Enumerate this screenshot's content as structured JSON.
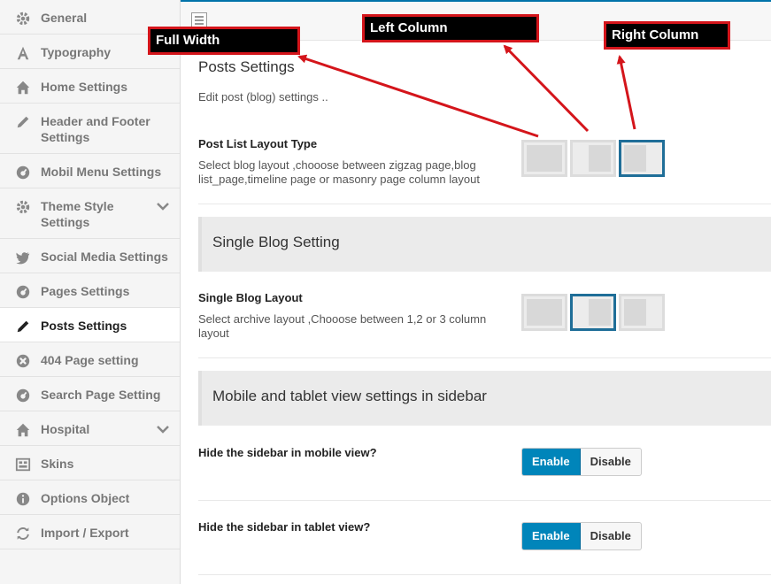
{
  "sidebar": {
    "items": [
      {
        "label": "General",
        "icon": "gear-icon"
      },
      {
        "label": "Typography",
        "icon": "typography-icon"
      },
      {
        "label": "Home Settings",
        "icon": "home-icon"
      },
      {
        "label": "Header and Footer Settings",
        "icon": "pencil-icon"
      },
      {
        "label": "Mobil Menu Settings",
        "icon": "dashboard-icon"
      },
      {
        "label": "Theme Style Settings",
        "icon": "gear-icon"
      },
      {
        "label": "Social Media Settings",
        "icon": "twitter-icon"
      },
      {
        "label": "Pages Settings",
        "icon": "dashboard-icon"
      },
      {
        "label": "Posts Settings",
        "icon": "pencil-icon"
      },
      {
        "label": "404 Page setting",
        "icon": "x-circle-icon"
      },
      {
        "label": "Search Page Setting",
        "icon": "dashboard-icon"
      },
      {
        "label": "Hospital",
        "icon": "home-icon"
      },
      {
        "label": "Skins",
        "icon": "skins-icon"
      },
      {
        "label": "Options Object",
        "icon": "info-icon"
      },
      {
        "label": "Import / Export",
        "icon": "refresh-icon"
      }
    ],
    "active": "Posts Settings"
  },
  "main": {
    "section_title": "Posts Settings",
    "section_desc": "Edit post (blog) settings ..",
    "post_list_layout": {
      "title": "Post List Layout Type",
      "desc_line1": "Select blog layout ,chooose between zigzag page,blog",
      "desc_line2": "list_page,timeline page or masonry page column layout",
      "selected": "right-column"
    },
    "single_blog_band": "Single Blog Setting",
    "single_blog_layout": {
      "title": "Single Blog Layout",
      "desc_line1": "Select archive layout ,Chooose between 1,2 or 3 column",
      "desc_line2": "layout",
      "selected": "left-column"
    },
    "mobile_band": "Mobile and tablet view settings in sidebar",
    "hide_mobile": {
      "title": "Hide the sidebar in mobile view?",
      "enable": "Enable",
      "disable": "Disable",
      "value": "Enable"
    },
    "hide_tablet": {
      "title": "Hide the sidebar in tablet view?",
      "enable": "Enable",
      "disable": "Disable",
      "value": "Enable"
    }
  },
  "annotations": {
    "full_width": "Full Width",
    "left_column": "Left Column",
    "right_column": "Right Column"
  },
  "colors": {
    "accent": "#0085ba",
    "selected_border": "#1f6e98",
    "annotation_red": "#d4151b"
  }
}
